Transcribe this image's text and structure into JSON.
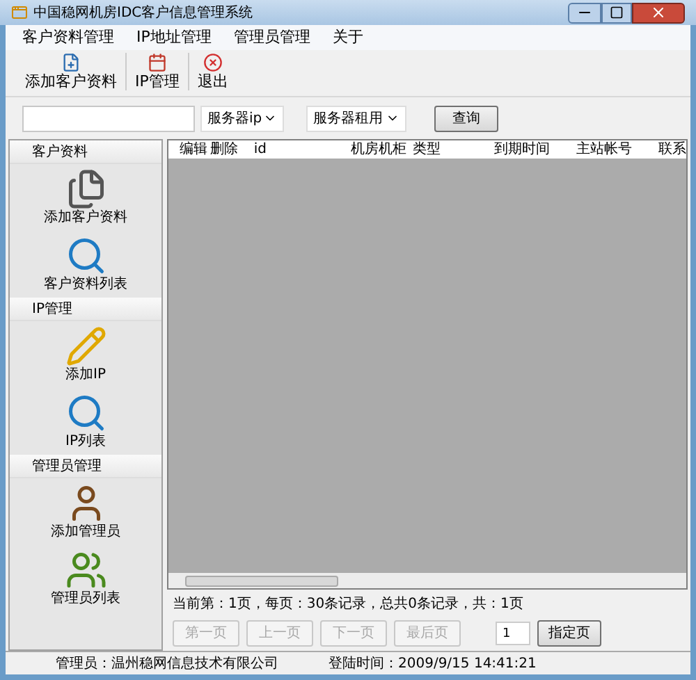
{
  "window": {
    "title": "中国稳网机房IDC客户信息管理系统"
  },
  "menu": [
    "客户资料管理",
    "IP地址管理",
    "管理员管理",
    "关于"
  ],
  "toolbar": [
    {
      "label": "添加客户资料",
      "kind": "add"
    },
    {
      "label": "IP管理",
      "kind": "ip"
    },
    {
      "label": "退出",
      "kind": "exit"
    }
  ],
  "search": {
    "dropdowns": [
      "服务器ip",
      "服务器租用"
    ],
    "button": "查询"
  },
  "sidebar": [
    {
      "title": "客户资料",
      "items": [
        {
          "label": "添加客户资料",
          "kind": "documents"
        },
        {
          "label": "客户资料列表",
          "kind": "search"
        }
      ]
    },
    {
      "title": "IP管理",
      "items": [
        {
          "label": "添加IP",
          "kind": "edit"
        },
        {
          "label": "IP列表",
          "kind": "search"
        }
      ]
    },
    {
      "title": "管理员管理",
      "items": [
        {
          "label": "添加管理员",
          "kind": "user"
        },
        {
          "label": "管理员列表",
          "kind": "users"
        }
      ]
    }
  ],
  "table": {
    "columns": [
      "编辑",
      "删除",
      "id",
      "机房机柜",
      "类型",
      "到期时间",
      "主站帐号",
      "联系"
    ]
  },
  "pager": {
    "info": "当前第：1页，每页：30条记录，总共0条记录，共：1页",
    "buttons": [
      {
        "label": "第一页",
        "disabled": true
      },
      {
        "label": "上一页",
        "disabled": true
      },
      {
        "label": "下一页",
        "disabled": true
      },
      {
        "label": "最后页",
        "disabled": true
      }
    ],
    "page_input": "1",
    "go_button": {
      "label": "指定页",
      "disabled": false
    }
  },
  "status_bar": {
    "admin": "管理员：温州稳网信息技术有限公司",
    "login_time": "登陆时间：2009/9/15 14:41:21"
  }
}
